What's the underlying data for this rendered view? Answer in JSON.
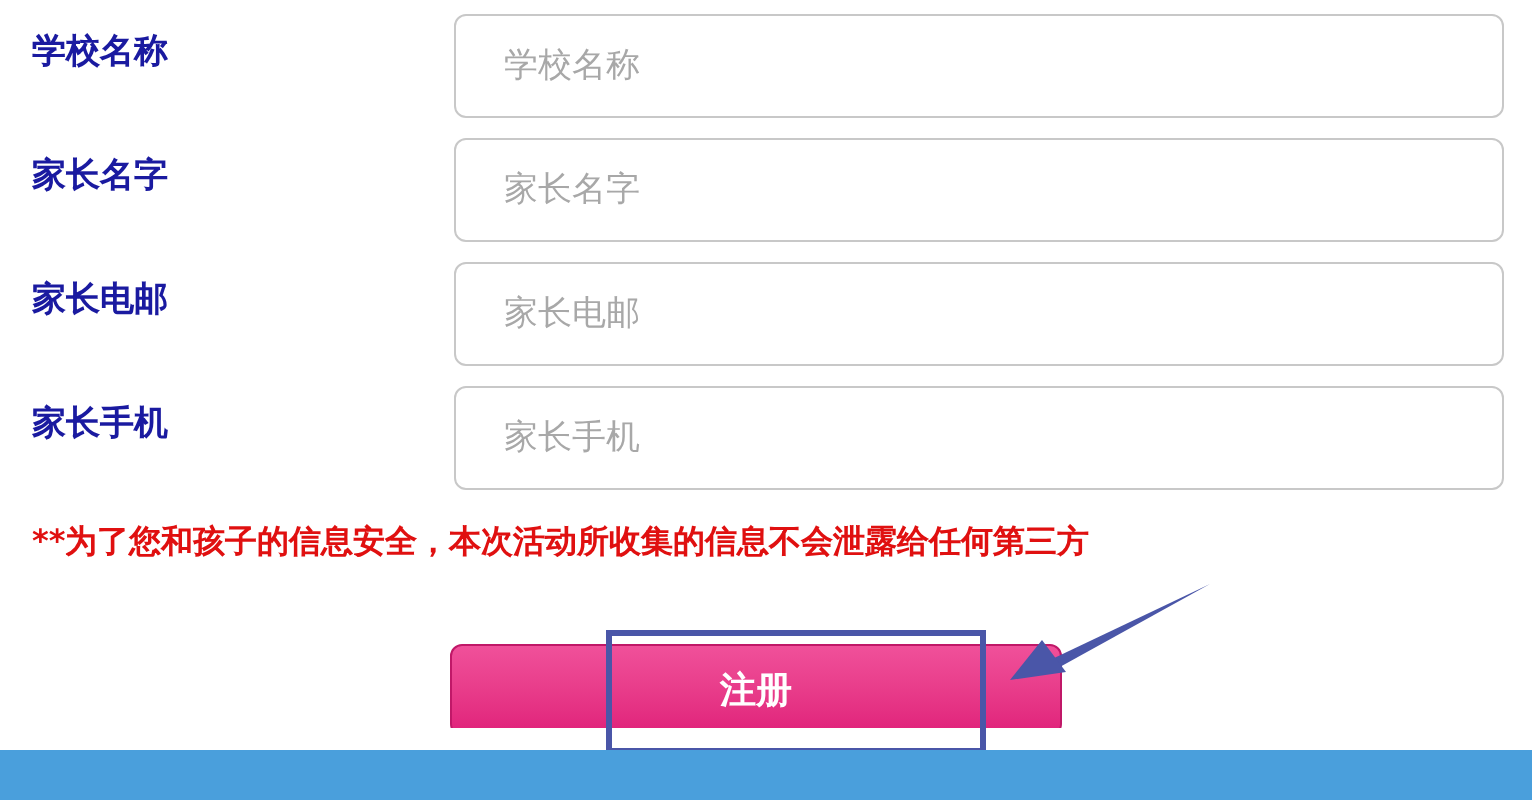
{
  "fields": [
    {
      "label": "学校名称",
      "placeholder": "学校名称"
    },
    {
      "label": "家长名字",
      "placeholder": "家长名字"
    },
    {
      "label": "家长电邮",
      "placeholder": "家长电邮"
    },
    {
      "label": "家长手机",
      "placeholder": "家长手机"
    }
  ],
  "notice": "**为了您和孩子的信息安全，本次活动所收集的信息不会泄露给任何第三方",
  "submit_button": "注册"
}
